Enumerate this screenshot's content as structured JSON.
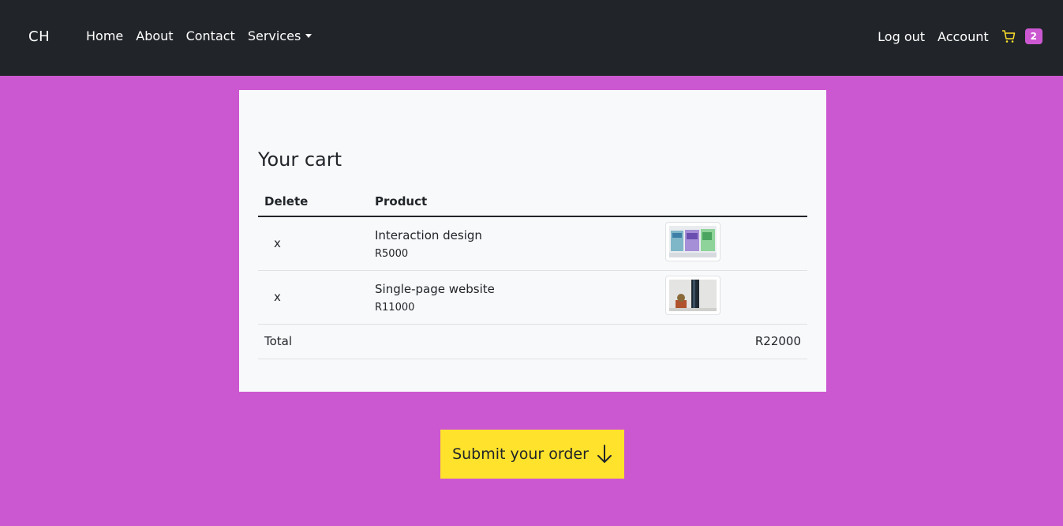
{
  "navbar": {
    "brand": "CH",
    "links": [
      "Home",
      "About",
      "Contact",
      "Services"
    ],
    "logout": "Log out",
    "account": "Account",
    "cart_count": "2",
    "cart_icon": "shopping-cart-icon"
  },
  "cart": {
    "title": "Your cart",
    "headers": {
      "delete": "Delete",
      "product": "Product"
    },
    "items": [
      {
        "delete": "x",
        "name": "Interaction design",
        "price": "R5000",
        "image": "interaction-design-thumbnail"
      },
      {
        "delete": "x",
        "name": "Single-page website",
        "price": "R11000",
        "image": "single-page-website-thumbnail"
      }
    ],
    "total_label": "Total",
    "total_value": "R22000"
  },
  "submit": {
    "label": "Submit your order",
    "icon": "arrow-down-icon"
  },
  "colors": {
    "background": "#cc58d1",
    "navbar": "#212529",
    "button": "#ffe22b",
    "cart_icon": "#ffe22b",
    "badge": "#cc58d1"
  }
}
